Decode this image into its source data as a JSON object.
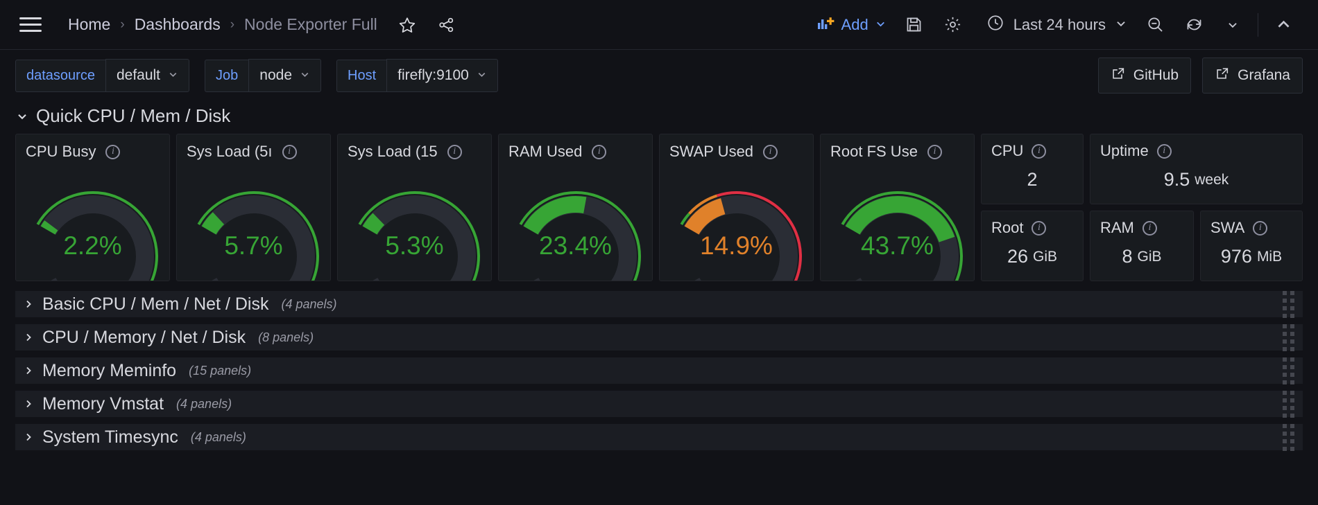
{
  "nav": {
    "menu_icon": "hamburger-icon",
    "breadcrumb": [
      {
        "label": "Home",
        "current": false
      },
      {
        "label": "Dashboards",
        "current": false
      },
      {
        "label": "Node Exporter Full",
        "current": true
      }
    ],
    "separator": "›",
    "star_icon": "star-icon",
    "share_icon": "share-icon",
    "add_label": "Add",
    "add_icon": "add-panel-icon",
    "save_icon": "save-icon",
    "settings_icon": "gear-icon",
    "time_icon": "clock-icon",
    "time_range": "Last 24 hours",
    "zoom_out_icon": "zoom-out-icon",
    "refresh_icon": "refresh-icon",
    "collapse_icon": "chevron-up-icon",
    "chevron_down": "chevron-down-icon"
  },
  "variables": [
    {
      "label": "datasource",
      "value": "default",
      "has_label_box": true
    },
    {
      "label": "Job",
      "value": "node",
      "has_label_box": true
    },
    {
      "label": "Host",
      "value": "firefly:9100",
      "has_label_box": true
    }
  ],
  "links": [
    {
      "label": "GitHub",
      "icon": "external-link-icon"
    },
    {
      "label": "Grafana",
      "icon": "external-link-icon"
    }
  ],
  "open_row": {
    "title": "Quick CPU / Mem / Disk",
    "chevron": "chevron-down-icon"
  },
  "colors": {
    "green": "#37a535",
    "orange": "#e0812a",
    "red": "#e02f44",
    "track": "#2a2d35",
    "panel_bg": "#181b1f",
    "page_bg": "#111217",
    "accent_blue": "#6e9fff",
    "text": "#d8d9df"
  },
  "gauges": [
    {
      "title": "CPU Busy",
      "value": "2.2%",
      "pct": 2.2,
      "color": "green",
      "thresholds": [
        {
          "from": 0,
          "to": 85,
          "color": "green"
        },
        {
          "from": 85,
          "to": 95,
          "color": "orange"
        },
        {
          "from": 95,
          "to": 100,
          "color": "red"
        }
      ]
    },
    {
      "title": "Sys Load (5ı",
      "value": "5.7%",
      "pct": 5.7,
      "color": "green",
      "thresholds": [
        {
          "from": 0,
          "to": 85,
          "color": "green"
        },
        {
          "from": 85,
          "to": 95,
          "color": "orange"
        },
        {
          "from": 95,
          "to": 100,
          "color": "red"
        }
      ]
    },
    {
      "title": "Sys Load (15",
      "value": "5.3%",
      "pct": 5.3,
      "color": "green",
      "thresholds": [
        {
          "from": 0,
          "to": 85,
          "color": "green"
        },
        {
          "from": 85,
          "to": 95,
          "color": "orange"
        },
        {
          "from": 95,
          "to": 100,
          "color": "red"
        }
      ]
    },
    {
      "title": "RAM Used",
      "value": "23.4%",
      "pct": 23.4,
      "color": "green",
      "thresholds": [
        {
          "from": 0,
          "to": 80,
          "color": "green"
        },
        {
          "from": 80,
          "to": 90,
          "color": "orange"
        },
        {
          "from": 90,
          "to": 100,
          "color": "red"
        }
      ]
    },
    {
      "title": "SWAP Used",
      "value": "14.9%",
      "pct": 14.9,
      "color": "orange",
      "thresholds": [
        {
          "from": 0,
          "to": 4,
          "color": "green"
        },
        {
          "from": 4,
          "to": 14,
          "color": "orange"
        },
        {
          "from": 14,
          "to": 100,
          "color": "red"
        }
      ]
    },
    {
      "title": "Root FS Use",
      "value": "43.7%",
      "pct": 43.7,
      "color": "green",
      "thresholds": [
        {
          "from": 0,
          "to": 85,
          "color": "green"
        },
        {
          "from": 85,
          "to": 95,
          "color": "orange"
        },
        {
          "from": 95,
          "to": 100,
          "color": "red"
        }
      ]
    }
  ],
  "stats": {
    "top": [
      {
        "title": "CPU",
        "value": "2",
        "unit": ""
      },
      {
        "title": "Uptime",
        "value": "9.5",
        "unit": "week"
      }
    ],
    "bottom": [
      {
        "title": "Root",
        "value": "26",
        "unit": "GiB"
      },
      {
        "title": "RAM",
        "value": "8",
        "unit": "GiB"
      },
      {
        "title": "SWA",
        "value": "976",
        "unit": "MiB"
      }
    ]
  },
  "collapsed_rows": [
    {
      "title": "Basic CPU / Mem / Net / Disk",
      "count": "(4 panels)"
    },
    {
      "title": "CPU / Memory / Net / Disk",
      "count": "(8 panels)"
    },
    {
      "title": "Memory Meminfo",
      "count": "(15 panels)"
    },
    {
      "title": "Memory Vmstat",
      "count": "(4 panels)"
    },
    {
      "title": "System Timesync",
      "count": "(4 panels)"
    }
  ]
}
